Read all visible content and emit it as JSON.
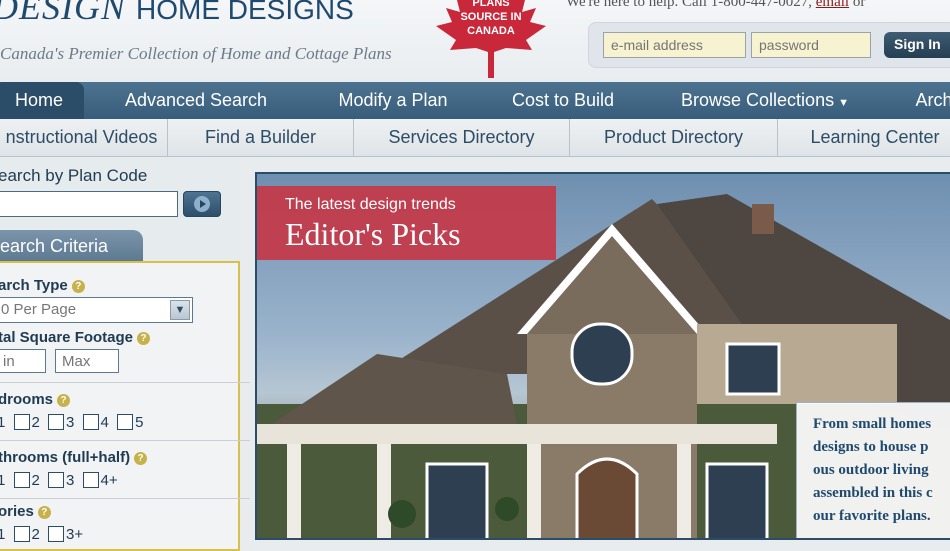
{
  "header": {
    "logo_text": "DESIGN",
    "logo_sub": "HOME DESIGNS",
    "tagline": "Canada's Premier Collection of Home and Cottage Plans",
    "badge_lines": [
      "PLANS",
      "SOURCE IN",
      "CANADA"
    ],
    "help_text": "We're here to help. Call 1-800-447-0027,",
    "help_link": "email",
    "help_tail": "or",
    "email_placeholder": "e-mail address",
    "password_placeholder": "password",
    "signin_label": "Sign In",
    "badge_color": "#c8283a"
  },
  "main_nav": [
    {
      "label": "Home",
      "active": true
    },
    {
      "label": "Advanced Search"
    },
    {
      "label": "Modify a Plan"
    },
    {
      "label": "Cost to Build"
    },
    {
      "label": "Browse Collections",
      "dropdown": true
    },
    {
      "label": "Arch"
    }
  ],
  "sub_nav": [
    {
      "label": "nstructional Videos"
    },
    {
      "label": "Find a Builder"
    },
    {
      "label": "Services Directory"
    },
    {
      "label": "Product Directory"
    },
    {
      "label": "Learning Center"
    }
  ],
  "sidebar": {
    "plan_code_label": "earch by Plan Code",
    "criteria_tab": "earch Criteria",
    "search_type_label": "arch Type",
    "search_type_value": "0 Per Page",
    "sqft_label": "tal Square Footage",
    "sqft_min_placeholder": "in",
    "sqft_max_placeholder": "Max",
    "bedrooms_label": "drooms",
    "bedroom_options": [
      "1",
      "2",
      "3",
      "4",
      "5"
    ],
    "bathrooms_label": "throoms (full+half)",
    "bathroom_options": [
      "1",
      "2",
      "3",
      "4+"
    ],
    "stories_label": "ories",
    "story_options": [
      "1",
      "2",
      "3+"
    ]
  },
  "hero": {
    "kicker": "The latest design trends",
    "title": "Editor's Picks",
    "caption_lines": [
      "From small homes",
      "designs to house p",
      "ous outdoor living",
      "assembled in this c",
      "our favorite plans."
    ]
  }
}
